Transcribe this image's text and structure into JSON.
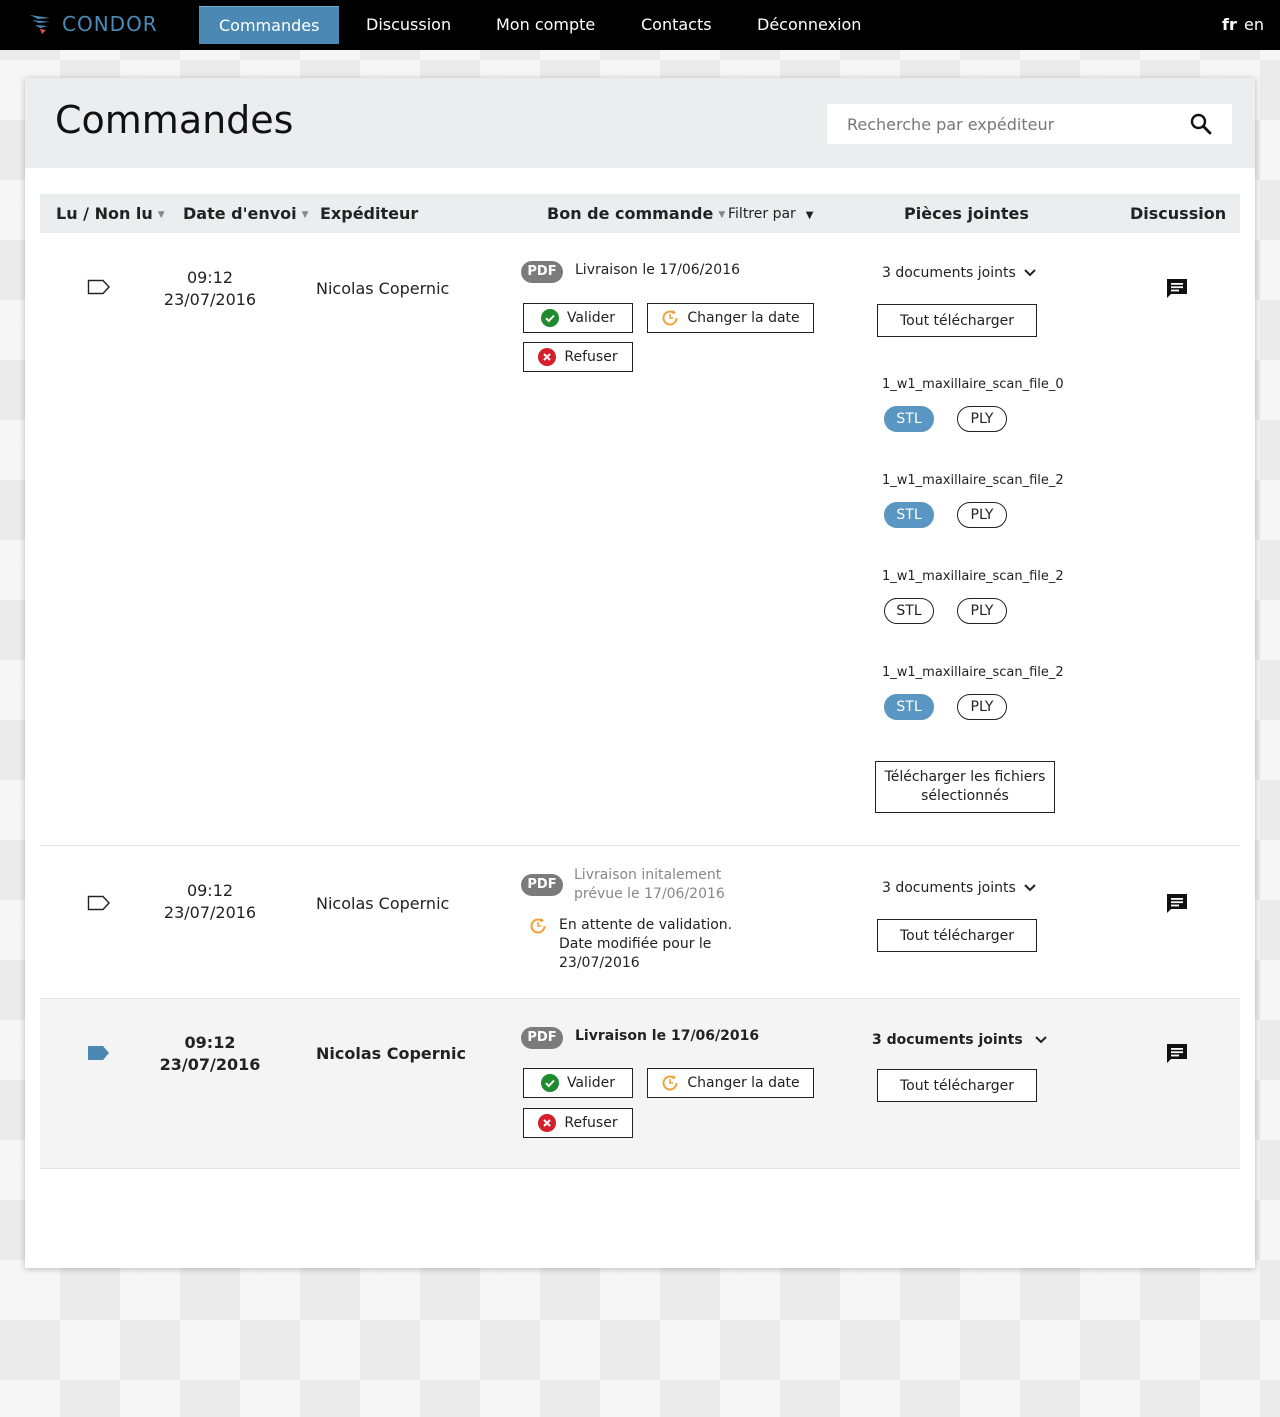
{
  "app": {
    "logo_text": "CONDOR"
  },
  "nav": {
    "items": [
      "Commandes",
      "Discussion",
      "Mon compte",
      "Contacts",
      "Déconnexion"
    ],
    "languages": [
      "fr",
      "en"
    ]
  },
  "page": {
    "title": "Commandes",
    "search_placeholder": "Recherche par expéditeur"
  },
  "table": {
    "headers": {
      "read": "Lu / Non lu",
      "date": "Date d'envoi",
      "sender": "Expéditeur",
      "order": "Bon de commande",
      "filter": "Filtrer par",
      "attachments": "Pièces jointes",
      "discussion": "Discussion"
    },
    "rows": [
      {
        "read": true,
        "time": "09:12",
        "date": "23/07/2016",
        "sender": "Nicolas Copernic",
        "pdf": "PDF",
        "delivery": "Livraison le 17/06/2016",
        "actions": {
          "validate": "Valider",
          "change_date": "Changer la date",
          "refuse": "Refuser"
        },
        "docs": "3 documents joints",
        "download_all": "Tout télécharger",
        "files": [
          {
            "name": "1_w1_maxillaire_scan_file_0",
            "formats": [
              "STL",
              "PLY"
            ],
            "selected": [
              "STL"
            ]
          },
          {
            "name": "1_w1_maxillaire_scan_file_2",
            "formats": [
              "STL",
              "PLY"
            ],
            "selected": [
              "STL"
            ]
          },
          {
            "name": "1_w1_maxillaire_scan_file_2",
            "formats": [
              "STL",
              "PLY"
            ],
            "selected": []
          },
          {
            "name": "1_w1_maxillaire_scan_file_2",
            "formats": [
              "STL",
              "PLY"
            ],
            "selected": [
              "STL"
            ]
          }
        ],
        "download_selected_line1": "Télécharger les fichiers",
        "download_selected_line2": "sélectionnés"
      },
      {
        "read": true,
        "time": "09:12",
        "date": "23/07/2016",
        "sender": "Nicolas Copernic",
        "pdf": "PDF",
        "delivery_line1": "Livraison initalement",
        "delivery_line2": "prévue le 17/06/2016",
        "pending_line1": "En attente de validation.",
        "pending_line2": "Date modifiée pour le",
        "pending_line3": "23/07/2016",
        "docs": "3 documents joints",
        "download_all": "Tout télécharger"
      },
      {
        "read": false,
        "time": "09:12",
        "date": "23/07/2016",
        "sender": "Nicolas Copernic",
        "pdf": "PDF",
        "delivery": "Livraison le 17/06/2016",
        "actions": {
          "validate": "Valider",
          "change_date": "Changer la date",
          "refuse": "Refuser"
        },
        "docs": "3 documents joints",
        "download_all": "Tout télécharger"
      }
    ]
  },
  "colors": {
    "accent": "#4b88b4",
    "pill_selected": "#5a96c2",
    "validate": "#1f8a2e",
    "refuse": "#d4202a",
    "change_date": "#f0a23a",
    "unread_tag": "#4b88b4"
  }
}
